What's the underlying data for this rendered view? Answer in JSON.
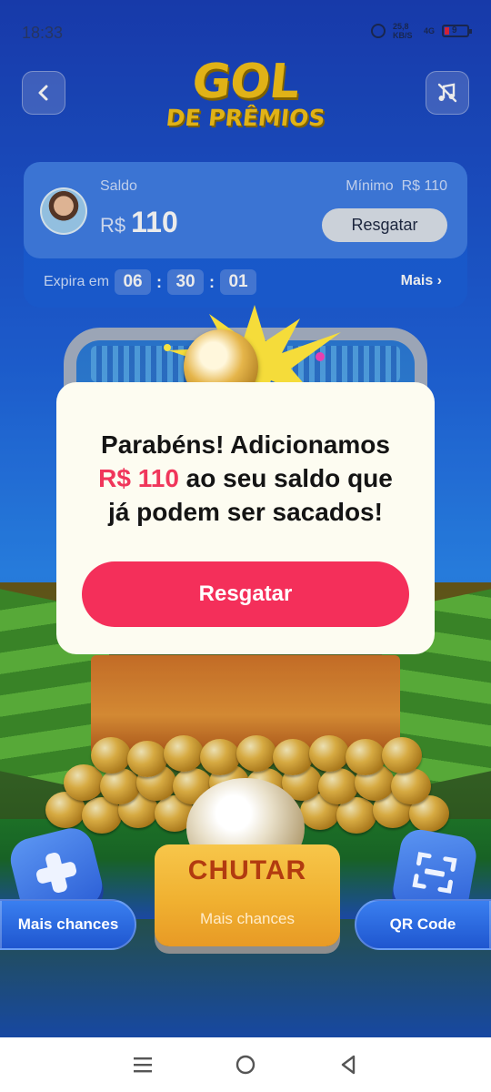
{
  "status_bar": {
    "time": "18:33",
    "net_speed": "25,8 KB/S",
    "network": "4G",
    "battery_level": "9"
  },
  "header": {
    "logo_line1": "GOL",
    "logo_line2": "DE PRÊMIOS",
    "back_icon": "chevron-left-icon",
    "music_icon": "music-off-icon"
  },
  "balance_card": {
    "saldo_label": "Saldo",
    "currency": "R$",
    "amount": "110",
    "minimo_label": "Mínimo  R$ 110",
    "resgatar_label": "Resgatar",
    "expira_label": "Expira em",
    "timer": [
      "06",
      "30",
      "01"
    ],
    "mais_label": "Mais ›"
  },
  "dialog": {
    "line1": "Parabéns! Adicionamos",
    "amount": "R$ 110",
    "line2_rest": " ao seu saldo que",
    "line3": "já podem ser sacados!",
    "button_label": "Resgatar",
    "accent_color": "#f42f5a"
  },
  "bottom": {
    "left_label": "Mais chances",
    "right_label": "QR Code",
    "chutar_label": "CHUTAR",
    "chutar_sub": "Mais chances"
  },
  "nav": {
    "items": [
      "menu-icon",
      "home-icon",
      "back-icon"
    ]
  }
}
